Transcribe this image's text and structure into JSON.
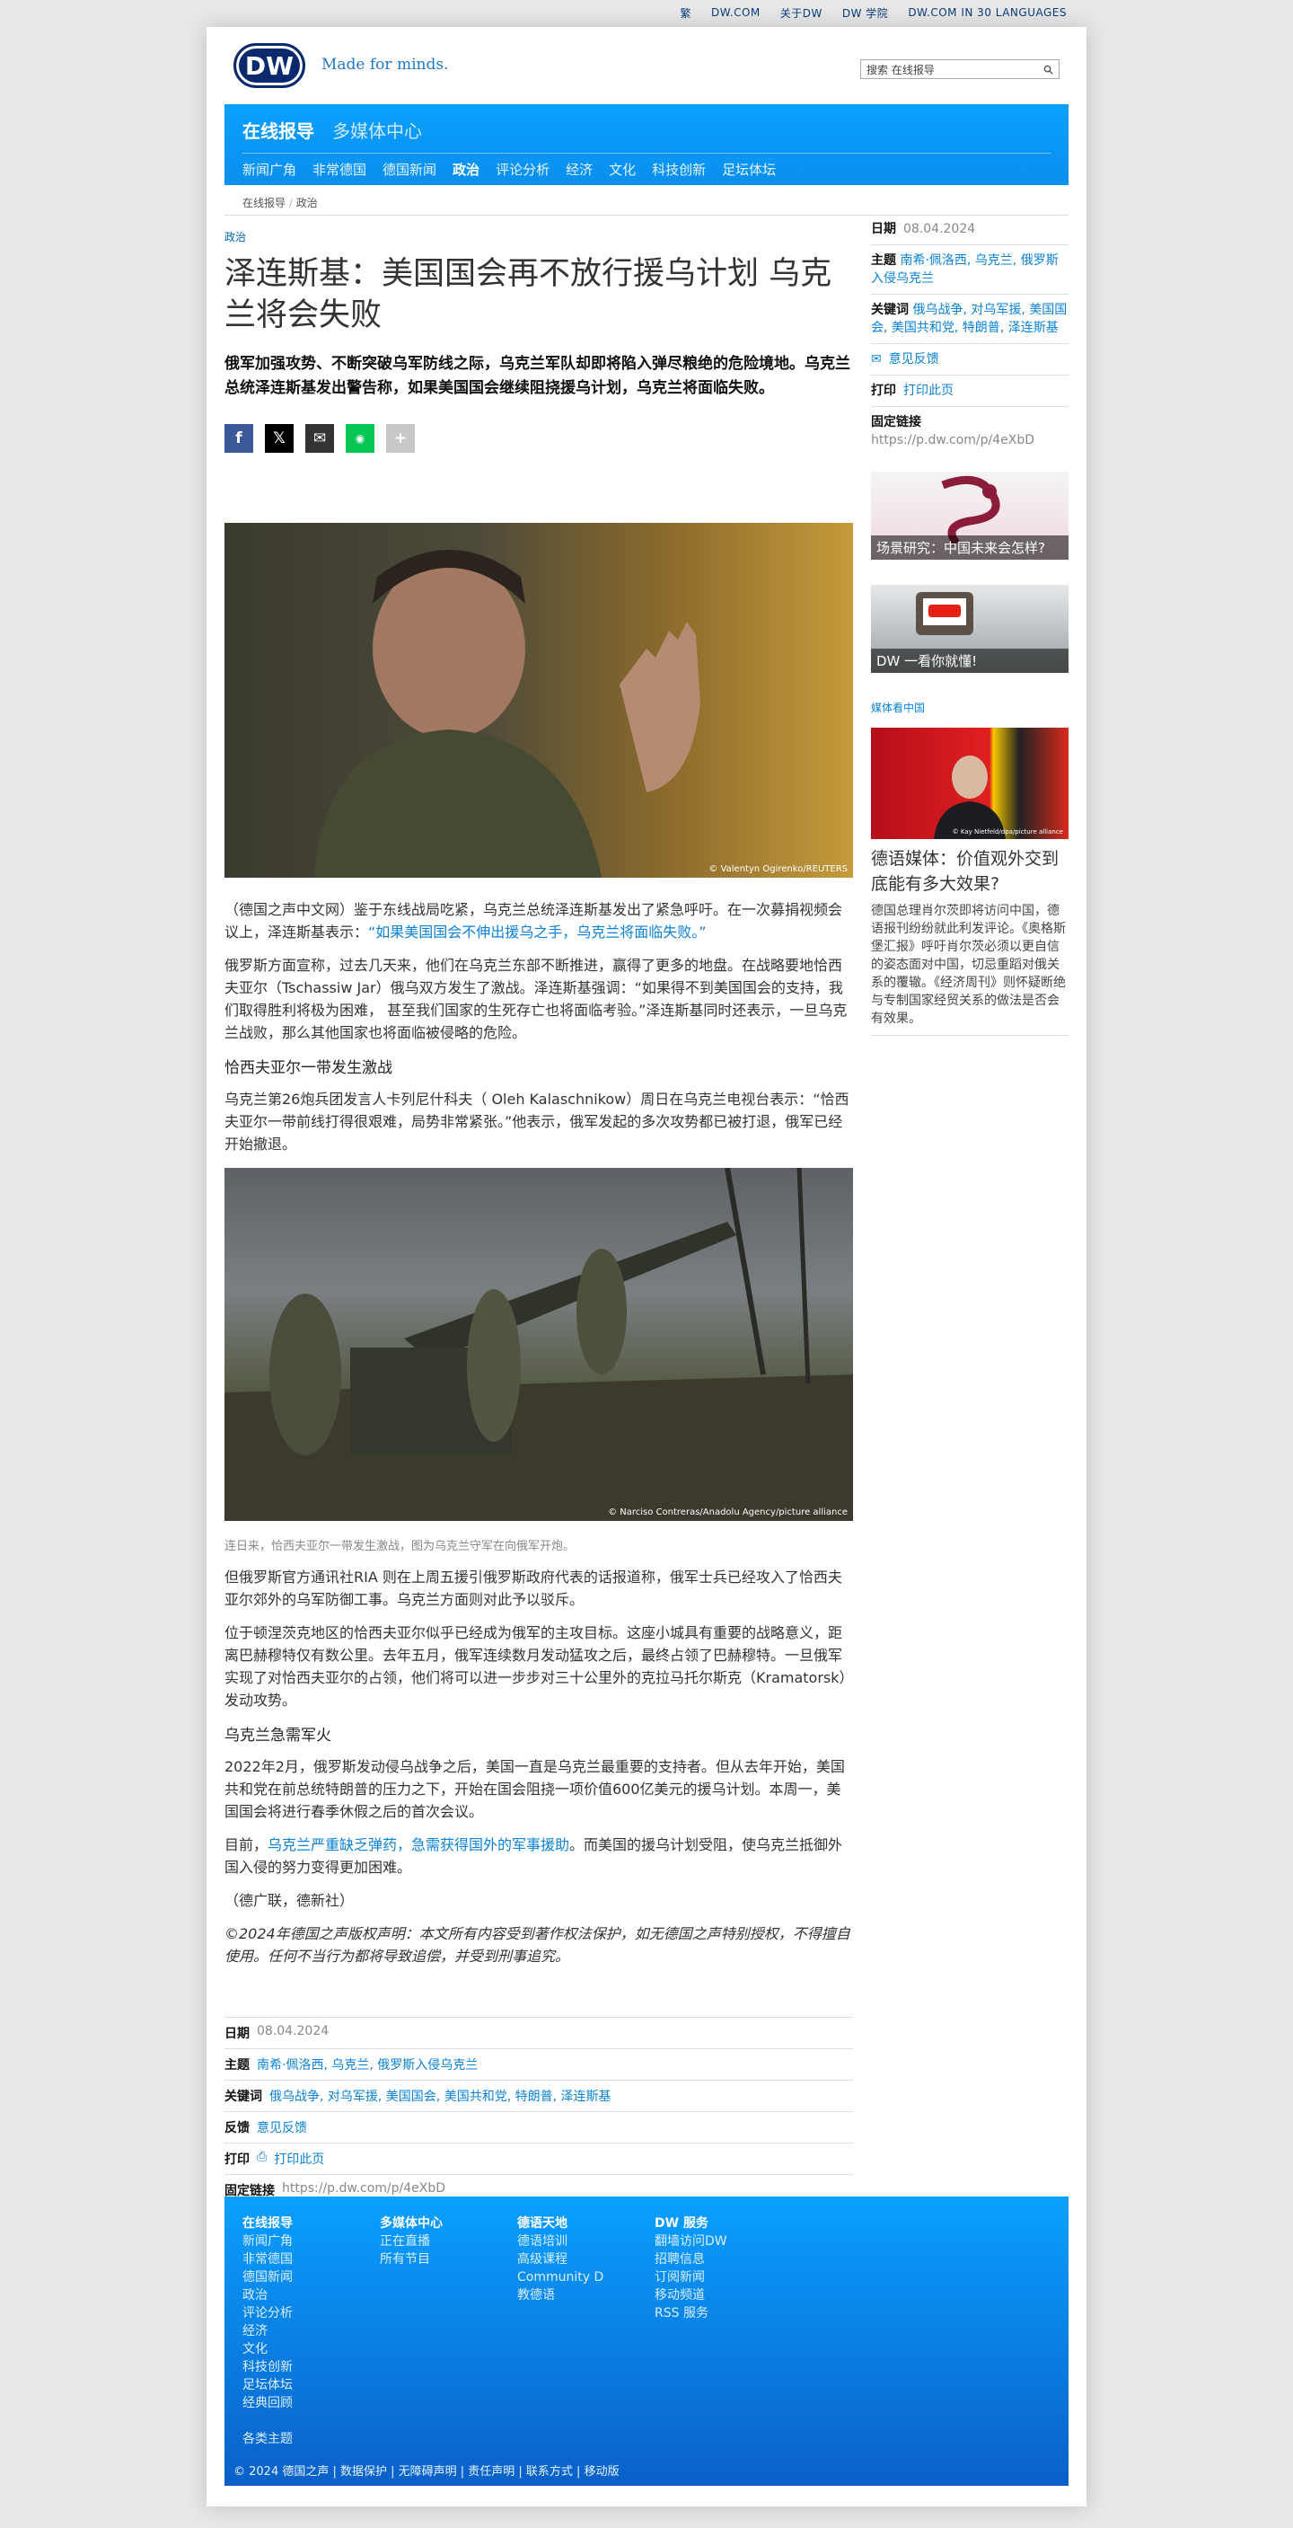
{
  "topbar": [
    "繁",
    "DW.COM",
    "关于DW",
    "DW 学院",
    "DW.COM IN 30 LANGUAGES"
  ],
  "header": {
    "logo": "DW",
    "tagline": "Made for minds.",
    "search_placeholder": "搜索 在线报导"
  },
  "nav": {
    "top": [
      "在线报导",
      "多媒体中心"
    ],
    "sub": [
      "新闻广角",
      "非常德国",
      "德国新闻",
      "政治",
      "评论分析",
      "经济",
      "文化",
      "科技创新",
      "足坛体坛"
    ]
  },
  "breadcrumb": [
    "在线报导",
    "政治"
  ],
  "article": {
    "kicker": "政治",
    "title": "泽连斯基：美国国会再不放行援乌计划 乌克兰将会失败",
    "lead": "俄军加强攻势、不断突破乌军防线之际，乌克兰军队却即将陷入弹尽粮绝的危险境地。乌克兰总统泽连斯基发出警告称，如果美国国会继续阻挠援乌计划，乌克兰将面临失败。",
    "img1_credit": "© Valentyn Ogirenko/REUTERS",
    "p1_pre": "（德国之声中文网）鉴于东线战局吃紧，乌克兰总统泽连斯基发出了紧急呼吁。在一次募捐视频会议上，泽连斯基表示：",
    "p1_link": "“如果美国国会不伸出援乌之手，乌克兰将面临失败。”",
    "p2": "俄罗斯方面宣称，过去几天来，他们在乌克兰东部不断推进，赢得了更多的地盘。在战略要地恰西夫亚尔（Tschassiw Jar）俄乌双方发生了激战。泽连斯基强调：“如果得不到美国国会的支持，我们取得胜利将极为困难， 甚至我们国家的生死存亡也将面临考验。”泽连斯基同时还表示，一旦乌克兰战败，那么其他国家也将面临被侵略的危险。",
    "h1": "恰西夫亚尔一带发生激战",
    "p3": "乌克兰第26炮兵团发言人卡列尼什科夫（ Oleh Kalaschnikow）周日在乌克兰电视台表示：“恰西夫亚尔一带前线打得很艰难，局势非常紧张。”他表示，俄军发起的多次攻势都已被打退，俄军已经开始撤退。",
    "img2_credit": "© Narciso Contreras/Anadolu Agency/picture alliance",
    "img2_caption": "连日来，恰西夫亚尔一带发生激战，图为乌克兰守军在向俄军开炮。",
    "p4": "但俄罗斯官方通讯社RIA 则在上周五援引俄罗斯政府代表的话报道称，俄军士兵已经攻入了恰西夫亚尔郊外的乌军防御工事。乌克兰方面则对此予以驳斥。",
    "p5": "位于顿涅茨克地区的恰西夫亚尔似乎已经成为俄军的主攻目标。这座小城具有重要的战略意义，距离巴赫穆特仅有数公里。去年五月，俄军连续数月发动猛攻之后，最终占领了巴赫穆特。一旦俄军实现了对恰西夫亚尔的占领，他们将可以进一步步对三十公里外的克拉马托尔斯克（Kramatorsk）发动攻势。",
    "h2": "乌克兰急需军火",
    "p6": "2022年2月，俄罗斯发动侵乌战争之后，美国一直是乌克兰最重要的支持者。但从去年开始，美国共和党在前总统特朗普的压力之下，开始在国会阻挠一项价值600亿美元的援乌计划。本周一，美国国会将进行春季休假之后的首次会议。",
    "p7_pre": "目前，",
    "p7_link": "乌克兰严重缺乏弹药，急需获得国外的军事援助",
    "p7_post": "。而美国的援乌计划受阻，使乌克兰抵御外国入侵的努力变得更加困难。",
    "p8": "（德广联，德新社）",
    "p9": "©2024年德国之声版权声明：本文所有内容受到著作权法保护，如无德国之声特别授权，不得擅自使用。任何不当行为都将导致追偿，并受到刑事追究。"
  },
  "meta": {
    "date_label": "日期",
    "date": "08.04.2024",
    "topic_label": "主题",
    "topic": "南希·佩洛西, 乌克兰, 俄罗斯入侵乌克兰",
    "keywords_label": "关键词",
    "keywords": "俄乌战争, 对乌军援, 美国国会, 美国共和党, 特朗普, 泽连斯基",
    "feedback_label": "反馈",
    "feedback": "意见反馈",
    "print_label": "打印",
    "print": "打印此页",
    "link_label": "固定链接",
    "link": "https://p.dw.com/p/4eXbD"
  },
  "sidebar": {
    "teaser1": "场景研究：中国未来会怎样?",
    "teaser2": "DW 一看你就懂!",
    "media_head": "媒体看中国",
    "media_credit": "© Kay Nietfeld/dpa/picture alliance",
    "media_title": "德语媒体：价值观外交到底能有多大效果?",
    "media_text": "德国总理肖尔茨即将访问中国，德语报刊纷纷就此利发评论。《奥格斯堡汇报》呼吁肖尔茨必须以更自信的姿态面对中国，切忌重蹈对俄关系的覆辙。《经济周刊》则怀疑断绝与专制国家经贸关系的做法是否会有效果。"
  },
  "footer": {
    "col1": [
      "在线报导",
      "新闻广角",
      "非常德国",
      "德国新闻",
      "政治",
      "评论分析",
      "经济",
      "文化",
      "科技创新",
      "足坛体坛",
      "经典回顾"
    ],
    "col1_extra": "各类主题",
    "col2": [
      "多媒体中心",
      "正在直播",
      "所有节目"
    ],
    "col3": [
      "德语天地",
      "德语培训",
      "高级课程",
      "Community D",
      "教德语"
    ],
    "col4": [
      "DW 服务",
      "翻墙访问DW",
      "招聘信息",
      "订阅新闻",
      "移动频道",
      "RSS 服务"
    ],
    "bottom": "© 2024 德国之声 | 数据保护 | 无障碍声明 | 责任声明 | 联系方式 | 移动版"
  },
  "colors": {
    "brand_blue": "#0a9bff",
    "link_blue": "#0b82d6",
    "logo_navy": "#0b2a6e"
  }
}
